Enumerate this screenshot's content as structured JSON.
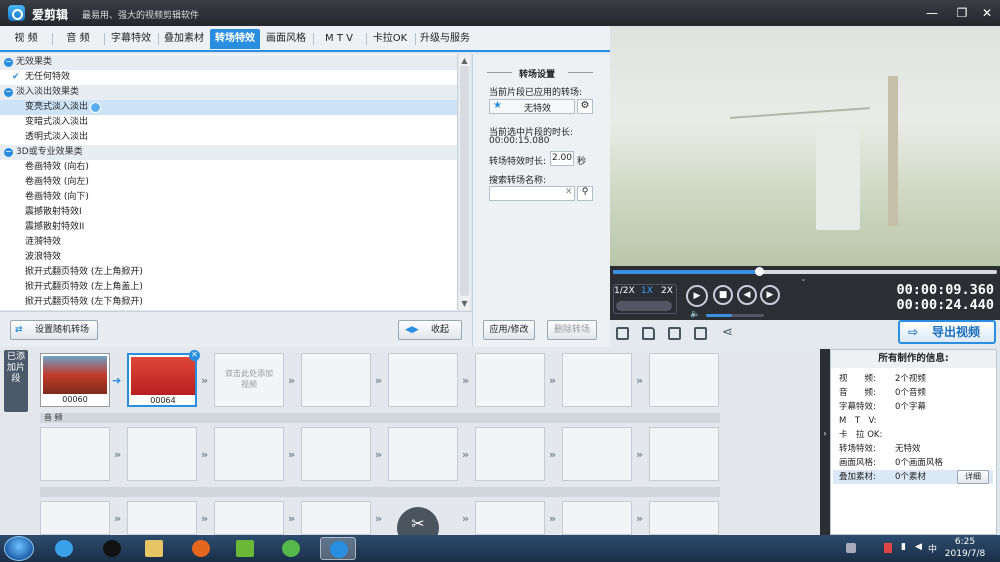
{
  "app": {
    "name": "爱剪辑",
    "slogan": "最易用、强大的视频剪辑软件",
    "window_buttons": [
      "—",
      "❐",
      "✕"
    ]
  },
  "tabs": [
    {
      "label": "视 频"
    },
    {
      "label": "音 频"
    },
    {
      "label": "字幕特效"
    },
    {
      "label": "叠加素材"
    },
    {
      "label": "转场特效",
      "active": true
    },
    {
      "label": "画面风格"
    },
    {
      "label": "M T V"
    },
    {
      "label": "卡拉OK"
    },
    {
      "label": "升级与服务"
    }
  ],
  "effect_list": [
    {
      "type": "cat",
      "label": "无效果类"
    },
    {
      "type": "item",
      "label": "无任何特效",
      "checked": true
    },
    {
      "type": "cat",
      "label": "淡入淡出效果类"
    },
    {
      "type": "item",
      "label": "变亮式淡入淡出",
      "selected": true
    },
    {
      "type": "item",
      "label": "变暗式淡入淡出"
    },
    {
      "type": "item",
      "label": "透明式淡入淡出"
    },
    {
      "type": "cat",
      "label": "3D或专业效果类"
    },
    {
      "type": "item",
      "label": "卷画特效 (向右)"
    },
    {
      "type": "item",
      "label": "卷画特效 (向左)"
    },
    {
      "type": "item",
      "label": "卷画特效 (向下)"
    },
    {
      "type": "item",
      "label": "震撼散射特效I"
    },
    {
      "type": "item",
      "label": "震撼散射特效II"
    },
    {
      "type": "item",
      "label": "涟漪特效"
    },
    {
      "type": "item",
      "label": "波浪特效"
    },
    {
      "type": "item",
      "label": "掀开式翻页特效 (左上角掀开)"
    },
    {
      "type": "item",
      "label": "掀开式翻页特效 (左上角盖上)"
    },
    {
      "type": "item",
      "label": "掀开式翻页特效 (左下角掀开)"
    }
  ],
  "left_buttons": {
    "random": "设置随机转场",
    "collapse": "收起"
  },
  "settings": {
    "title": "转场设置",
    "applied_label": "当前片段已应用的转场:",
    "applied_value": "无特效",
    "duration_label": "当前选中片段的时长:",
    "duration_value": "00:00:15.080",
    "effect_duration_label": "转场特效时长:",
    "effect_duration_value": "2.00",
    "effect_duration_unit": "秒",
    "search_label": "搜索转场名称:",
    "search_value": "",
    "apply_button": "应用/修改",
    "delete_button": "删除转场"
  },
  "player": {
    "speeds": [
      "1/2X",
      "1X",
      "2X"
    ],
    "active_speed": "1X",
    "current_time": "00:00:09.360",
    "total_time": "00:00:24.440",
    "progress_fraction": 0.38,
    "volume_fraction": 0.45
  },
  "export_button": "导出视频",
  "timeline": {
    "added_label": "已添加片段",
    "clips": [
      {
        "name": "00060"
      },
      {
        "name": "00064"
      }
    ],
    "empty_slot_hint": "双击此处添加视频",
    "audio_label": "音 频"
  },
  "info_panel": {
    "title": "所有制作的信息:",
    "rows": [
      {
        "key": "视　　频:",
        "value": "2个视频"
      },
      {
        "key": "音　　频:",
        "value": "0个音频"
      },
      {
        "key": "字幕特效:",
        "value": "0个字幕"
      },
      {
        "key": "M　T　V:",
        "value": ""
      },
      {
        "key": "卡　拉 OK:",
        "value": ""
      },
      {
        "key": "转场特效:",
        "value": "无特效"
      },
      {
        "key": "画面风格:",
        "value": "0个画面风格"
      },
      {
        "key": "叠加素材:",
        "value": "0个素材"
      }
    ],
    "detail_button": "详细"
  },
  "taskbar": {
    "time": "6:25",
    "date": "2019/7/8"
  },
  "colors": {
    "accent": "#2a8ee0",
    "dark_panel": "#2b2e33"
  }
}
